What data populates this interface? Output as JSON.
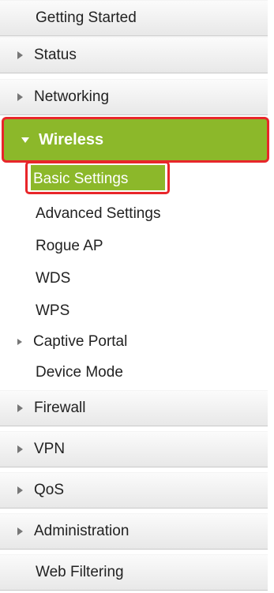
{
  "nav": {
    "getting_started": "Getting Started",
    "status": "Status",
    "networking": "Networking",
    "wireless": "Wireless",
    "wireless_sub": {
      "basic_settings": "Basic Settings",
      "advanced_settings": "Advanced Settings",
      "rogue_ap": "Rogue AP",
      "wds": "WDS",
      "wps": "WPS",
      "captive_portal": "Captive Portal",
      "device_mode": "Device Mode"
    },
    "firewall": "Firewall",
    "vpn": "VPN",
    "qos": "QoS",
    "administration": "Administration",
    "web_filtering": "Web Filtering"
  },
  "colors": {
    "active_green": "#8cb82a",
    "highlight_red": "#e8262a"
  }
}
